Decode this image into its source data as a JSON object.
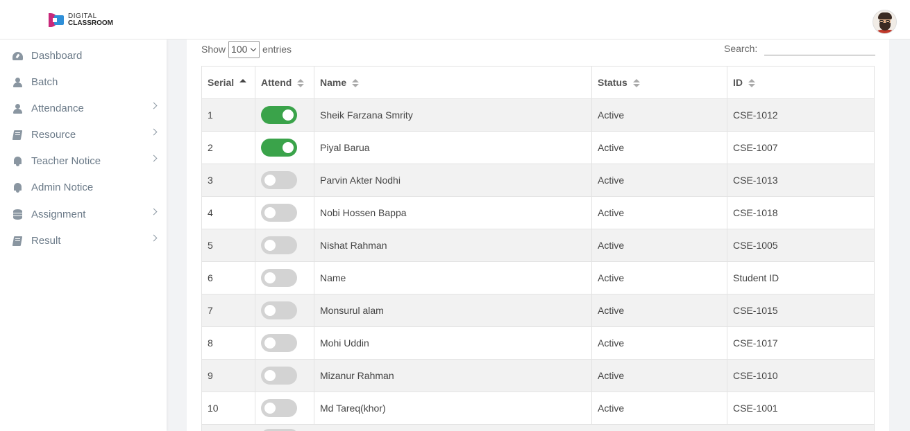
{
  "brand": {
    "line1": "DIGITAL",
    "line2": "CLASSROOM"
  },
  "sidebar": {
    "items": [
      {
        "label": "Dashboard",
        "icon": "gauge-icon",
        "has_submenu": false
      },
      {
        "label": "Batch",
        "icon": "user-icon",
        "has_submenu": false
      },
      {
        "label": "Attendance",
        "icon": "user-icon",
        "has_submenu": true
      },
      {
        "label": "Resource",
        "icon": "book-icon",
        "has_submenu": true
      },
      {
        "label": "Teacher Notice",
        "icon": "bell-icon",
        "has_submenu": true
      },
      {
        "label": "Admin Notice",
        "icon": "bell-icon",
        "has_submenu": false
      },
      {
        "label": "Assignment",
        "icon": "database-icon",
        "has_submenu": true
      },
      {
        "label": "Result",
        "icon": "book-icon",
        "has_submenu": true
      }
    ]
  },
  "table_controls": {
    "show_label": "Show",
    "page_size": "100",
    "entries_label": "entries",
    "search_label": "Search:",
    "search_value": ""
  },
  "table": {
    "columns": [
      "Serial",
      "Attend",
      "Name",
      "Status",
      "ID"
    ],
    "sorted_column": "Serial",
    "rows": [
      {
        "serial": "1",
        "attend": true,
        "name": "Sheik Farzana Smrity",
        "status": "Active",
        "id": "CSE-1012"
      },
      {
        "serial": "2",
        "attend": true,
        "name": "Piyal Barua",
        "status": "Active",
        "id": "CSE-1007"
      },
      {
        "serial": "3",
        "attend": false,
        "name": "Parvin Akter Nodhi",
        "status": "Active",
        "id": "CSE-1013"
      },
      {
        "serial": "4",
        "attend": false,
        "name": "Nobi Hossen Bappa",
        "status": "Active",
        "id": "CSE-1018"
      },
      {
        "serial": "5",
        "attend": false,
        "name": "Nishat Rahman",
        "status": "Active",
        "id": "CSE-1005"
      },
      {
        "serial": "6",
        "attend": false,
        "name": "Name",
        "status": "Active",
        "id": "Student ID"
      },
      {
        "serial": "7",
        "attend": false,
        "name": "Monsurul alam",
        "status": "Active",
        "id": "CSE-1015"
      },
      {
        "serial": "8",
        "attend": false,
        "name": "Mohi Uddin",
        "status": "Active",
        "id": "CSE-1017"
      },
      {
        "serial": "9",
        "attend": false,
        "name": "Mizanur Rahman",
        "status": "Active",
        "id": "CSE-1010"
      },
      {
        "serial": "10",
        "attend": false,
        "name": "Md Tareq(khor)",
        "status": "Active",
        "id": "CSE-1001"
      }
    ]
  },
  "colors": {
    "toggle_on": "#3aa34a",
    "toggle_off": "#d3d3d3",
    "sidebar_text": "#6b7a88"
  }
}
